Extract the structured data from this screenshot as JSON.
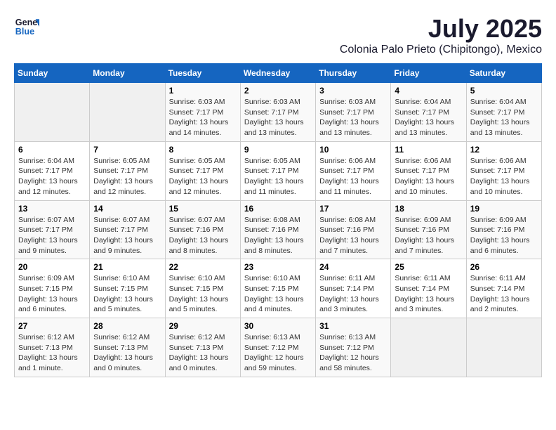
{
  "logo": {
    "line1": "General",
    "line2": "Blue"
  },
  "title": "July 2025",
  "subtitle": "Colonia Palo Prieto (Chipitongo), Mexico",
  "days_header": [
    "Sunday",
    "Monday",
    "Tuesday",
    "Wednesday",
    "Thursday",
    "Friday",
    "Saturday"
  ],
  "weeks": [
    [
      {
        "day": "",
        "detail": ""
      },
      {
        "day": "",
        "detail": ""
      },
      {
        "day": "1",
        "detail": "Sunrise: 6:03 AM\nSunset: 7:17 PM\nDaylight: 13 hours\nand 14 minutes."
      },
      {
        "day": "2",
        "detail": "Sunrise: 6:03 AM\nSunset: 7:17 PM\nDaylight: 13 hours\nand 13 minutes."
      },
      {
        "day": "3",
        "detail": "Sunrise: 6:03 AM\nSunset: 7:17 PM\nDaylight: 13 hours\nand 13 minutes."
      },
      {
        "day": "4",
        "detail": "Sunrise: 6:04 AM\nSunset: 7:17 PM\nDaylight: 13 hours\nand 13 minutes."
      },
      {
        "day": "5",
        "detail": "Sunrise: 6:04 AM\nSunset: 7:17 PM\nDaylight: 13 hours\nand 13 minutes."
      }
    ],
    [
      {
        "day": "6",
        "detail": "Sunrise: 6:04 AM\nSunset: 7:17 PM\nDaylight: 13 hours\nand 12 minutes."
      },
      {
        "day": "7",
        "detail": "Sunrise: 6:05 AM\nSunset: 7:17 PM\nDaylight: 13 hours\nand 12 minutes."
      },
      {
        "day": "8",
        "detail": "Sunrise: 6:05 AM\nSunset: 7:17 PM\nDaylight: 13 hours\nand 12 minutes."
      },
      {
        "day": "9",
        "detail": "Sunrise: 6:05 AM\nSunset: 7:17 PM\nDaylight: 13 hours\nand 11 minutes."
      },
      {
        "day": "10",
        "detail": "Sunrise: 6:06 AM\nSunset: 7:17 PM\nDaylight: 13 hours\nand 11 minutes."
      },
      {
        "day": "11",
        "detail": "Sunrise: 6:06 AM\nSunset: 7:17 PM\nDaylight: 13 hours\nand 10 minutes."
      },
      {
        "day": "12",
        "detail": "Sunrise: 6:06 AM\nSunset: 7:17 PM\nDaylight: 13 hours\nand 10 minutes."
      }
    ],
    [
      {
        "day": "13",
        "detail": "Sunrise: 6:07 AM\nSunset: 7:17 PM\nDaylight: 13 hours\nand 9 minutes."
      },
      {
        "day": "14",
        "detail": "Sunrise: 6:07 AM\nSunset: 7:17 PM\nDaylight: 13 hours\nand 9 minutes."
      },
      {
        "day": "15",
        "detail": "Sunrise: 6:07 AM\nSunset: 7:16 PM\nDaylight: 13 hours\nand 8 minutes."
      },
      {
        "day": "16",
        "detail": "Sunrise: 6:08 AM\nSunset: 7:16 PM\nDaylight: 13 hours\nand 8 minutes."
      },
      {
        "day": "17",
        "detail": "Sunrise: 6:08 AM\nSunset: 7:16 PM\nDaylight: 13 hours\nand 7 minutes."
      },
      {
        "day": "18",
        "detail": "Sunrise: 6:09 AM\nSunset: 7:16 PM\nDaylight: 13 hours\nand 7 minutes."
      },
      {
        "day": "19",
        "detail": "Sunrise: 6:09 AM\nSunset: 7:16 PM\nDaylight: 13 hours\nand 6 minutes."
      }
    ],
    [
      {
        "day": "20",
        "detail": "Sunrise: 6:09 AM\nSunset: 7:15 PM\nDaylight: 13 hours\nand 6 minutes."
      },
      {
        "day": "21",
        "detail": "Sunrise: 6:10 AM\nSunset: 7:15 PM\nDaylight: 13 hours\nand 5 minutes."
      },
      {
        "day": "22",
        "detail": "Sunrise: 6:10 AM\nSunset: 7:15 PM\nDaylight: 13 hours\nand 5 minutes."
      },
      {
        "day": "23",
        "detail": "Sunrise: 6:10 AM\nSunset: 7:15 PM\nDaylight: 13 hours\nand 4 minutes."
      },
      {
        "day": "24",
        "detail": "Sunrise: 6:11 AM\nSunset: 7:14 PM\nDaylight: 13 hours\nand 3 minutes."
      },
      {
        "day": "25",
        "detail": "Sunrise: 6:11 AM\nSunset: 7:14 PM\nDaylight: 13 hours\nand 3 minutes."
      },
      {
        "day": "26",
        "detail": "Sunrise: 6:11 AM\nSunset: 7:14 PM\nDaylight: 13 hours\nand 2 minutes."
      }
    ],
    [
      {
        "day": "27",
        "detail": "Sunrise: 6:12 AM\nSunset: 7:13 PM\nDaylight: 13 hours\nand 1 minute."
      },
      {
        "day": "28",
        "detail": "Sunrise: 6:12 AM\nSunset: 7:13 PM\nDaylight: 13 hours\nand 0 minutes."
      },
      {
        "day": "29",
        "detail": "Sunrise: 6:12 AM\nSunset: 7:13 PM\nDaylight: 13 hours\nand 0 minutes."
      },
      {
        "day": "30",
        "detail": "Sunrise: 6:13 AM\nSunset: 7:12 PM\nDaylight: 12 hours\nand 59 minutes."
      },
      {
        "day": "31",
        "detail": "Sunrise: 6:13 AM\nSunset: 7:12 PM\nDaylight: 12 hours\nand 58 minutes."
      },
      {
        "day": "",
        "detail": ""
      },
      {
        "day": "",
        "detail": ""
      }
    ]
  ]
}
